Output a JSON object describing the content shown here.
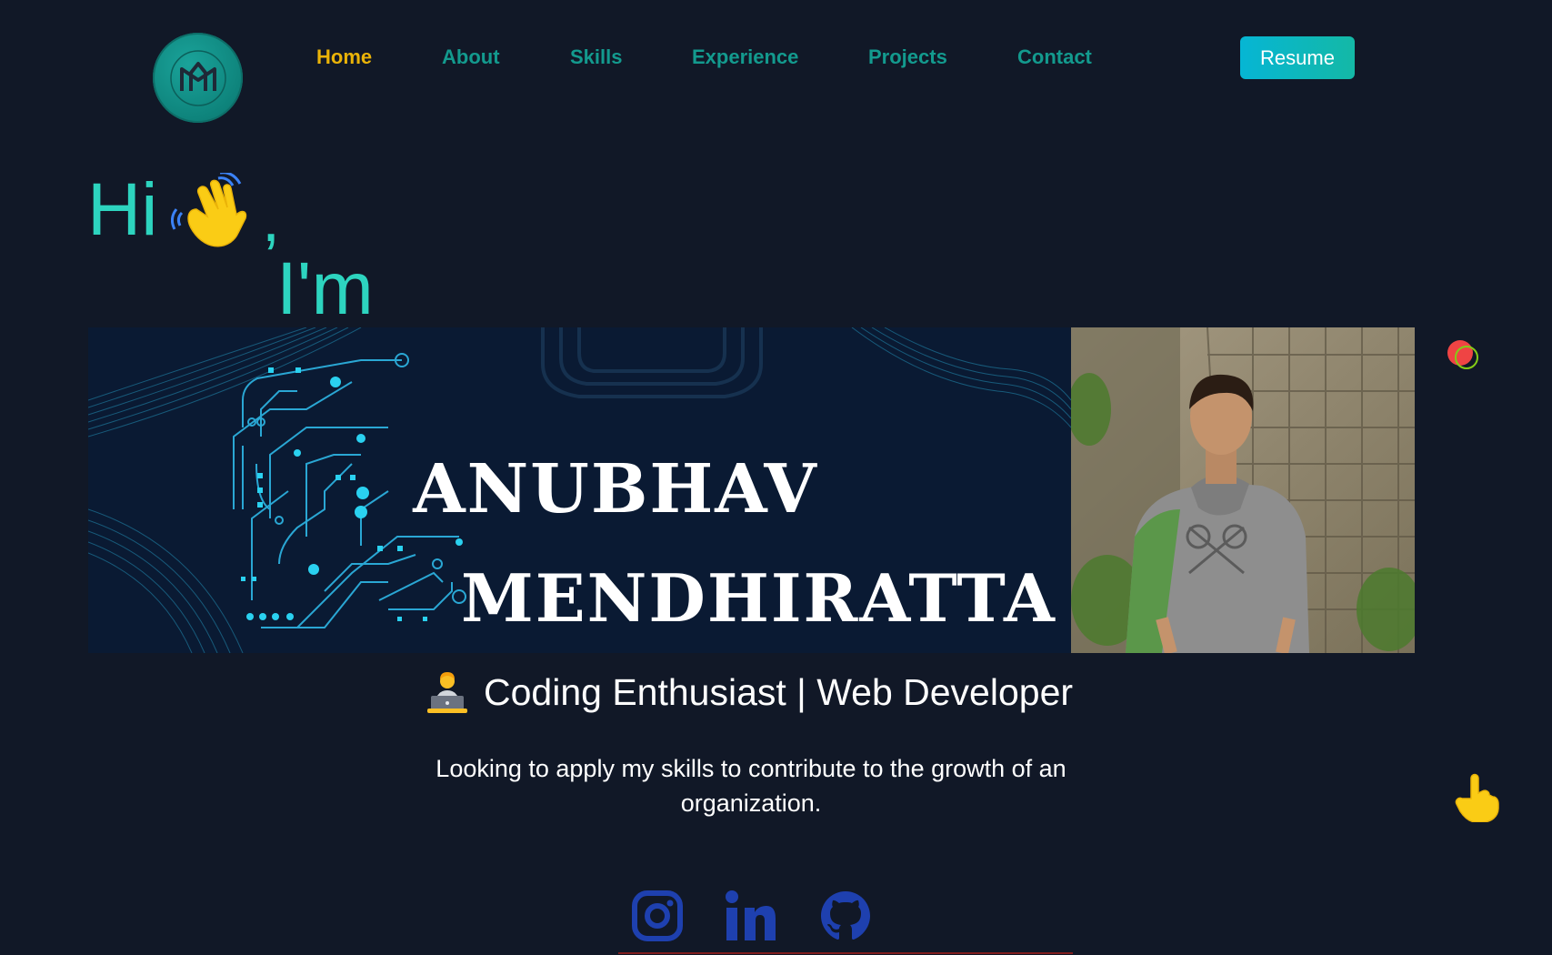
{
  "nav": {
    "items": [
      {
        "label": "Home",
        "active": true
      },
      {
        "label": "About",
        "active": false
      },
      {
        "label": "Skills",
        "active": false
      },
      {
        "label": "Experience",
        "active": false
      },
      {
        "label": "Projects",
        "active": false
      },
      {
        "label": "Contact",
        "active": false
      }
    ],
    "resume_label": "Resume"
  },
  "hero": {
    "hi": "Hi",
    "comma": ",",
    "im": "I'm",
    "banner_first_name": "ANUBHAV",
    "banner_last_name": "MENDHIRATTA",
    "tagline": "Coding Enthusiast | Web Developer",
    "description": "Looking to apply my skills to contribute to the growth of an organization."
  },
  "social": {
    "icons": [
      "instagram-icon",
      "linkedin-icon",
      "github-icon"
    ]
  },
  "colors": {
    "background": "#111827",
    "accent_teal": "#2dd4bf",
    "nav_teal": "#139a8e",
    "nav_active": "#eab308",
    "social_blue": "#1e40af"
  }
}
